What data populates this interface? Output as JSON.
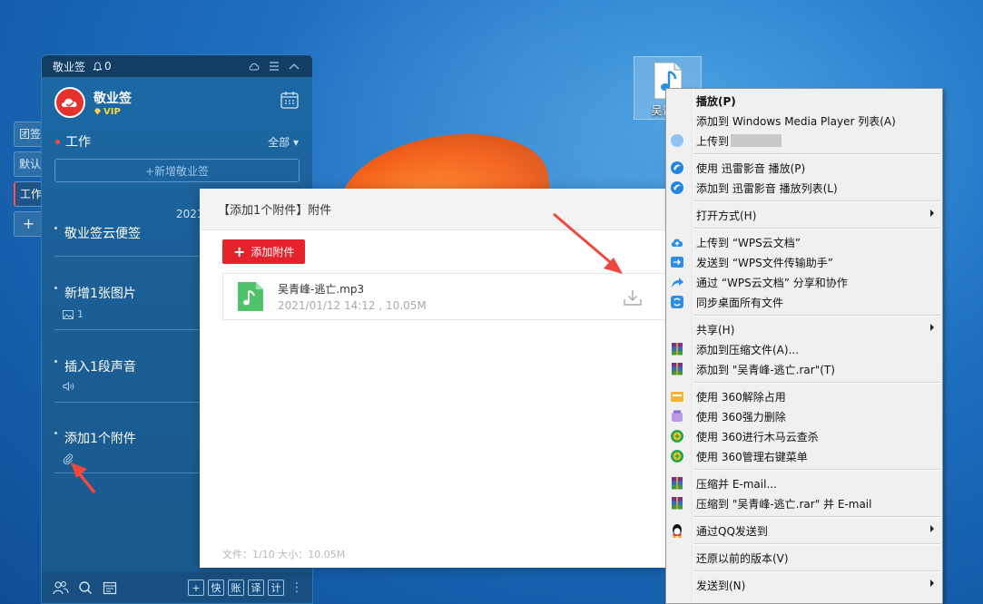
{
  "colors": {
    "accent_red": "#e5232c",
    "note_panel": "#1b5f96",
    "menu_bg": "#f0f0f0"
  },
  "side_tabs": [
    {
      "label": "团签"
    },
    {
      "label": "默认"
    },
    {
      "label": "工作"
    },
    {
      "label": "+"
    }
  ],
  "note_app": {
    "title": "敬业签",
    "notification_count": "0",
    "user": {
      "name": "敬业签",
      "badge": "VIP"
    },
    "section": {
      "name": "工作",
      "filter": "全部"
    },
    "new_note_label": "+新增敬业签",
    "date_peek": "2021",
    "notes": [
      {
        "title": "敬业签云便签",
        "sub": ""
      },
      {
        "title": "新增1张图片",
        "sub": "1"
      },
      {
        "title": "插入1段声音",
        "sub": ""
      },
      {
        "title": "添加1个附件",
        "sub": ""
      }
    ],
    "bottom_buttons": [
      "+",
      "快",
      "账",
      "译",
      "计"
    ]
  },
  "attach_panel": {
    "header": "【添加1个附件】附件",
    "add_button": "添加附件",
    "file": {
      "name": "吴青峰-逃亡.mp3",
      "meta": "2021/01/12 14:12 , 10.05M"
    },
    "footer": "文件：1/10   大小：10.05M"
  },
  "desktop_icon": {
    "label": "吴青峰"
  },
  "context_menu": {
    "items": [
      {
        "label": "播放(P)",
        "bold": true,
        "icon": "none"
      },
      {
        "label": "添加到 Windows Media Player 列表(A)",
        "icon": "none"
      },
      {
        "label": "上传到",
        "icon": "cloud-icon",
        "blurred": true
      },
      {
        "sep": true
      },
      {
        "label": "使用 迅雷影音 播放(P)",
        "icon": "xunlei-icon"
      },
      {
        "label": "添加到 迅雷影音 播放列表(L)",
        "icon": "xunlei-icon"
      },
      {
        "sep": true
      },
      {
        "label": "打开方式(H)",
        "icon": "none",
        "submenu": true
      },
      {
        "sep": true
      },
      {
        "label": "上传到 “WPS云文档”",
        "icon": "wps-cloud-icon"
      },
      {
        "label": "发送到 “WPS文件传输助手”",
        "icon": "wps-send-icon"
      },
      {
        "label": "通过 “WPS云文档” 分享和协作",
        "icon": "wps-share-icon"
      },
      {
        "label": "同步桌面所有文件",
        "icon": "wps-sync-icon"
      },
      {
        "sep": true
      },
      {
        "label": "共享(H)",
        "icon": "none",
        "submenu": true
      },
      {
        "label": "添加到压缩文件(A)...",
        "icon": "winrar-icon"
      },
      {
        "label": "添加到 \"吴青峰-逃亡.rar\"(T)",
        "icon": "winrar-icon"
      },
      {
        "sep": true
      },
      {
        "label": "使用 360解除占用",
        "icon": "unlock-360-icon"
      },
      {
        "label": "使用 360强力删除",
        "icon": "delete-360-icon"
      },
      {
        "label": "使用 360进行木马云查杀",
        "icon": "scan-360-icon"
      },
      {
        "label": "使用 360管理右键菜单",
        "icon": "menu-360-icon"
      },
      {
        "sep": true
      },
      {
        "label": "压缩并 E-mail...",
        "icon": "winrar-icon"
      },
      {
        "label": "压缩到 \"吴青峰-逃亡.rar\" 并 E-mail",
        "icon": "winrar-icon"
      },
      {
        "sep": true
      },
      {
        "label": "通过QQ发送到",
        "icon": "qq-icon",
        "submenu": true
      },
      {
        "sep": true
      },
      {
        "label": "还原以前的版本(V)",
        "icon": "none"
      },
      {
        "sep": true
      },
      {
        "label": "发送到(N)",
        "icon": "none",
        "submenu": true
      }
    ]
  }
}
